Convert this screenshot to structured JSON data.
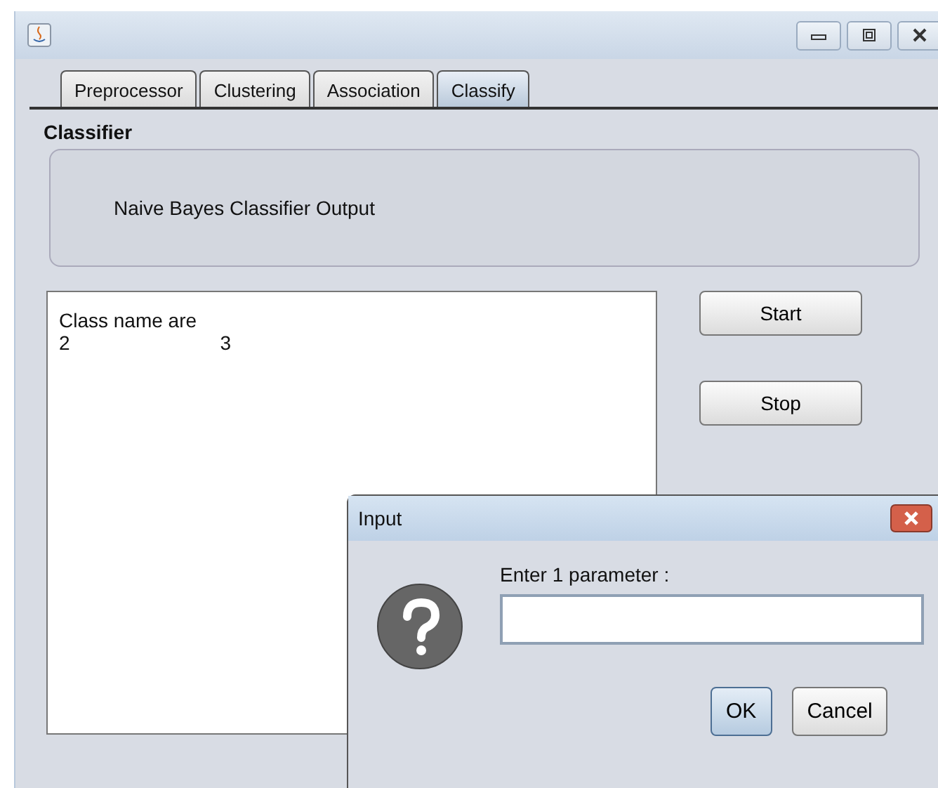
{
  "tabs": [
    {
      "label": "Preprocessor",
      "selected": false
    },
    {
      "label": "Clustering",
      "selected": false
    },
    {
      "label": "Association",
      "selected": false
    },
    {
      "label": "Classify",
      "selected": true
    }
  ],
  "classifier": {
    "label": "Classifier",
    "value": "Naive Bayes Classifier Output"
  },
  "output": {
    "heading": "Class name are",
    "values": [
      "2",
      "3"
    ]
  },
  "buttons": [
    "Start",
    "Stop"
  ],
  "dialog": {
    "title": "Input",
    "prompt": "Enter 1 parameter :",
    "buttons": [
      {
        "label": "OK",
        "selected": true
      },
      {
        "label": "Cancel",
        "selected": false
      }
    ]
  }
}
